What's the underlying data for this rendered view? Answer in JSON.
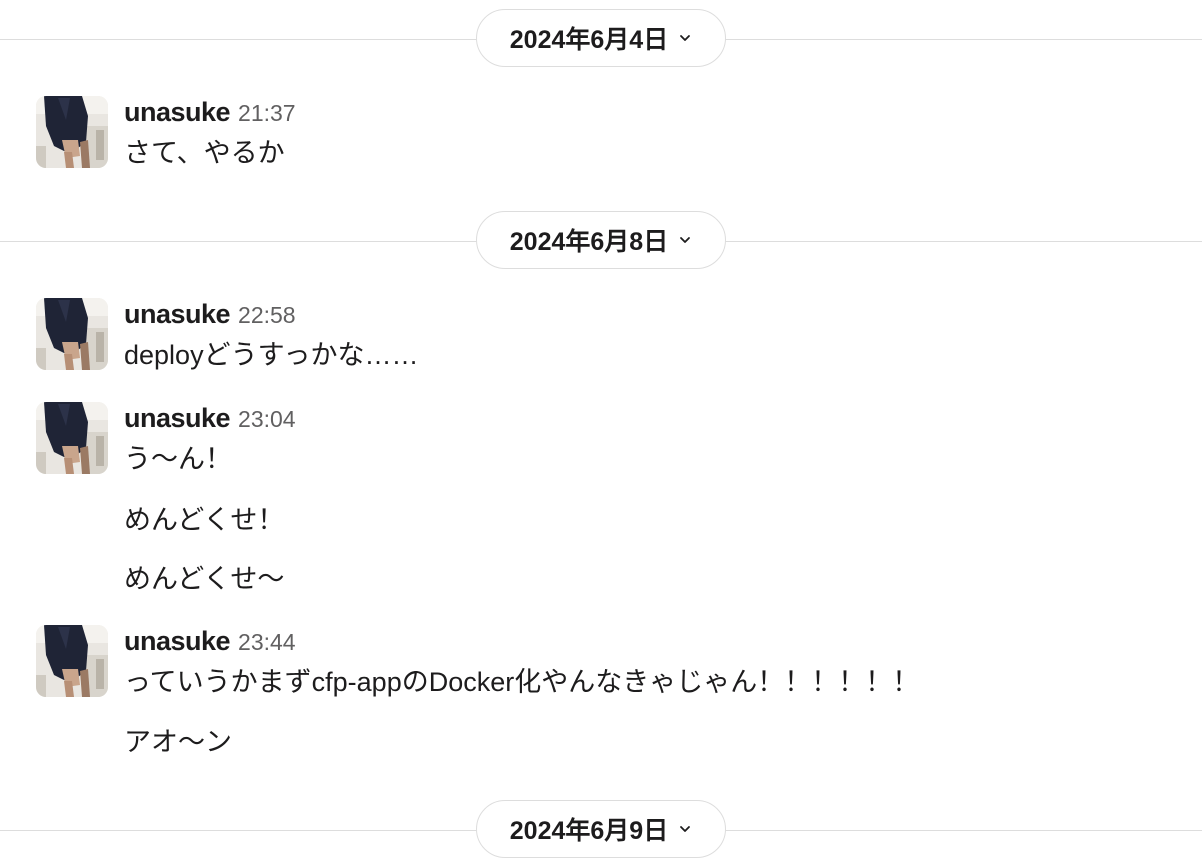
{
  "dividers": [
    {
      "label": "2024年6月4日"
    },
    {
      "label": "2024年6月8日"
    },
    {
      "label": "2024年6月9日"
    }
  ],
  "messages": [
    {
      "author": "unasuke",
      "time": "21:37",
      "lines": [
        "さて、やるか"
      ]
    },
    {
      "author": "unasuke",
      "time": "22:58",
      "lines": [
        "deployどうすっかな……"
      ]
    },
    {
      "author": "unasuke",
      "time": "23:04",
      "lines": [
        "う〜ん！",
        "めんどくせ！",
        "めんどくせ〜"
      ]
    },
    {
      "author": "unasuke",
      "time": "23:44",
      "lines": [
        "っていうかまずcfp-appのDocker化やんなきゃじゃん！！！！！！",
        "アオ〜ン"
      ]
    }
  ],
  "icons": {
    "date_toggle": "chevron-down-icon",
    "avatar": "user-avatar"
  },
  "colors": {
    "text": "#1d1c1d",
    "timestamp": "#616061",
    "divider": "#dddddd"
  }
}
